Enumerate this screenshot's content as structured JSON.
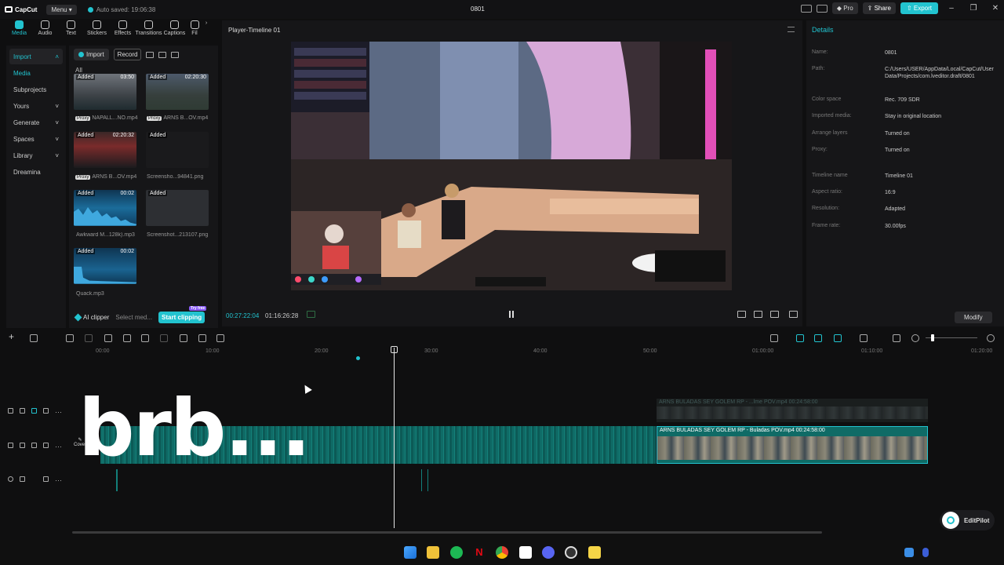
{
  "app": {
    "logo_text": "CapCut",
    "menu_label": "Menu",
    "autosave_text": "Auto saved: 19:06:38",
    "project_title": "0801",
    "pro_label": "Pro",
    "share_label": "Share",
    "export_label": "Export",
    "accent_color": "#22c3cf"
  },
  "tool_tabs": [
    {
      "label": "Media",
      "icon": "media-icon"
    },
    {
      "label": "Audio",
      "icon": "audio-icon"
    },
    {
      "label": "Text",
      "icon": "text-icon"
    },
    {
      "label": "Stickers",
      "icon": "sticker-icon"
    },
    {
      "label": "Effects",
      "icon": "effects-icon"
    },
    {
      "label": "Transitions",
      "icon": "transitions-icon"
    },
    {
      "label": "Captions",
      "icon": "captions-icon"
    },
    {
      "label": "Fil",
      "icon": "filters-icon"
    }
  ],
  "left_nav": [
    {
      "label": "Import"
    },
    {
      "label": "Media"
    },
    {
      "label": "Subprojects"
    },
    {
      "label": "Yours"
    },
    {
      "label": "Generate"
    },
    {
      "label": "Spaces"
    },
    {
      "label": "Library"
    },
    {
      "label": "Dreamina"
    }
  ],
  "media_panel": {
    "import_label": "Import",
    "record_label": "Record",
    "all_label": "All",
    "items": [
      {
        "status": "Added",
        "duration": "03:50",
        "name": "NAPALL...NO.mp4",
        "proxy": "Proxy"
      },
      {
        "status": "Added",
        "duration": "02:20:30",
        "name": "ARNS B...OV.mp4",
        "proxy": "Proxy"
      },
      {
        "status": "Added",
        "duration": "02:20:32",
        "name": "ARNS B...OV.mp4",
        "proxy": "Proxy"
      },
      {
        "status": "Added",
        "duration": "",
        "name": "Screensho...94841.png",
        "proxy": ""
      },
      {
        "status": "Added",
        "duration": "00:02",
        "name": "Awkward M...128k).mp3",
        "proxy": ""
      },
      {
        "status": "Added",
        "duration": "",
        "name": "Screenshot...213107.png",
        "proxy": ""
      },
      {
        "status": "Added",
        "duration": "00:02",
        "name": "Quack.mp3",
        "proxy": ""
      }
    ],
    "ai_clipper_label": "AI clipper",
    "select_media_label": "Select med...",
    "start_clipping_label": "Start clipping",
    "try_free_label": "Try free"
  },
  "player": {
    "title": "Player-Timeline 01",
    "current_time": "00:27:22:04",
    "total_time": "01:16:26:28"
  },
  "details": {
    "heading": "Details",
    "rows": [
      {
        "key": "Name:",
        "value": "0801"
      },
      {
        "key": "Path:",
        "value": "C:/Users/USER/AppData/Local/CapCut/User Data/Projects/com.lveditor.draft/0801"
      },
      {
        "key": "Color space",
        "value": "Rec. 709 SDR"
      },
      {
        "key": "Imported media:",
        "value": "Stay in original location"
      },
      {
        "key": "Arrange layers",
        "value": "Turned on"
      },
      {
        "key": "Proxy:",
        "value": "Turned on"
      },
      {
        "key": "Timeline name",
        "value": "Timeline 01"
      },
      {
        "key": "Aspect ratio:",
        "value": "16:9"
      },
      {
        "key": "Resolution:",
        "value": "Adapted"
      },
      {
        "key": "Frame rate:",
        "value": "30.00fps"
      }
    ],
    "modify_label": "Modify"
  },
  "timeline": {
    "ruler_labels": [
      "00:00",
      "10:00",
      "20:00",
      "30:00",
      "40:00",
      "50:00",
      "01:00:00",
      "01:10:00",
      "01:20:00"
    ],
    "main_clip_label": "ARNS BULADAS SEY GOLEM RP - Buladas  POV.mp4  00:24:58:00",
    "ghost_clip_label": "ARNS BULADAS SEY GOLEM RP - ...lme POV.mp4  00:24:58:00",
    "cover_label": "Cover",
    "overlay_text": "brb..."
  },
  "editpilot_label": "EditPilot"
}
